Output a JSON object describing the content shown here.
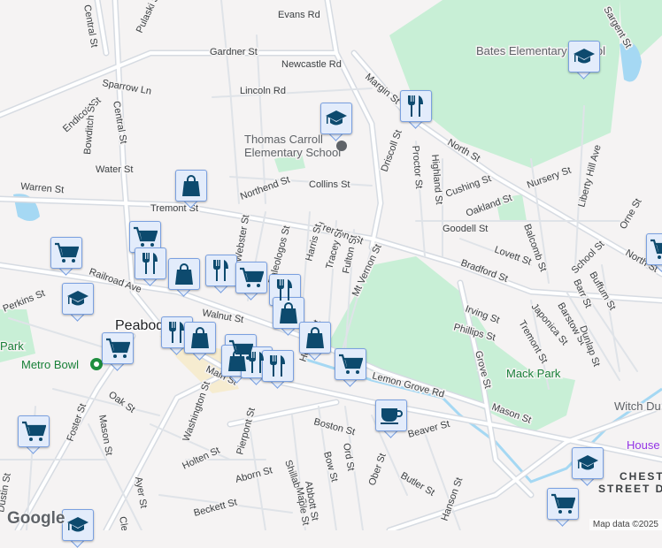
{
  "map": {
    "city_label": "Peabody",
    "district_label_1": "CHESTNUT",
    "district_label_2": "STREET DI",
    "streets": [
      "Evans Rd",
      "Gardner St",
      "Newcastle Rd",
      "Lincoln Rd",
      "Sparrow Ln",
      "Central St",
      "Pulaski St",
      "Endicott St",
      "Bowditch St",
      "Water St",
      "Warren St",
      "Tremont St",
      "Tremont St",
      "Northend St",
      "Collins St",
      "Webster St",
      "Paleologos St",
      "Harris St",
      "Tracey St",
      "Fulton St",
      "Mt Vernon St",
      "Railroad Ave",
      "Perkins St",
      "Walnut St",
      "Main St",
      "Oak St",
      "Foster St",
      "Washington St",
      "Mason St",
      "Holten St",
      "Pierpont St",
      "Boston St",
      "Aborn St",
      "Beckett St",
      "Shillaber St",
      "Maple St",
      "Abbott St",
      "Bow St",
      "Ord St",
      "Butler St",
      "Ober St",
      "Hanson St",
      "Howley St",
      "Grove St",
      "Mason St",
      "Beaver St",
      "Lovett St",
      "Bradford St",
      "Irving St",
      "Phillips St",
      "Tremont St",
      "Japonica St",
      "Barstow St",
      "Dunlap St",
      "Barr St",
      "Buffum St",
      "School St",
      "North St",
      "North St",
      "Goodell St",
      "Oakland St",
      "Cushing St",
      "Balcomb St",
      "Nursery St",
      "Liberty Hill Ave",
      "Highland St",
      "Proctor St",
      "Driscoll St",
      "Margin St",
      "Sargent St",
      "Orne St",
      "Dustin St",
      "Clement Ave",
      "Ayer St",
      "Lemon Grove Rd",
      "Central St"
    ],
    "pois": {
      "bates_school": "Bates Elementary School",
      "carroll_school_1": "Thomas Carroll",
      "carroll_school_2": "Elementary School",
      "metro_bowl": "Metro Bowl",
      "mack_park": "Mack Park",
      "park_left": "Park",
      "witch_dungeon": "Witch Du",
      "house": "House"
    },
    "markers": [
      "school",
      "restaurant",
      "school",
      "shopping",
      "grocery",
      "grocery",
      "restaurant",
      "shopping",
      "restaurant",
      "grocery",
      "restaurant",
      "shopping",
      "school",
      "grocery",
      "restaurant",
      "shopping",
      "grocery",
      "shopping",
      "restaurant",
      "restaurant",
      "shopping",
      "grocery",
      "cafe",
      "grocery",
      "school",
      "school",
      "grocery",
      "grocery"
    ],
    "logo": "Google",
    "attribution": "Map data ©2025"
  },
  "colors": {
    "marker_fill": "#e3ecfb",
    "marker_icon": "#0d4a6e",
    "park": "#c8efd6",
    "water": "#a5d8f3"
  }
}
